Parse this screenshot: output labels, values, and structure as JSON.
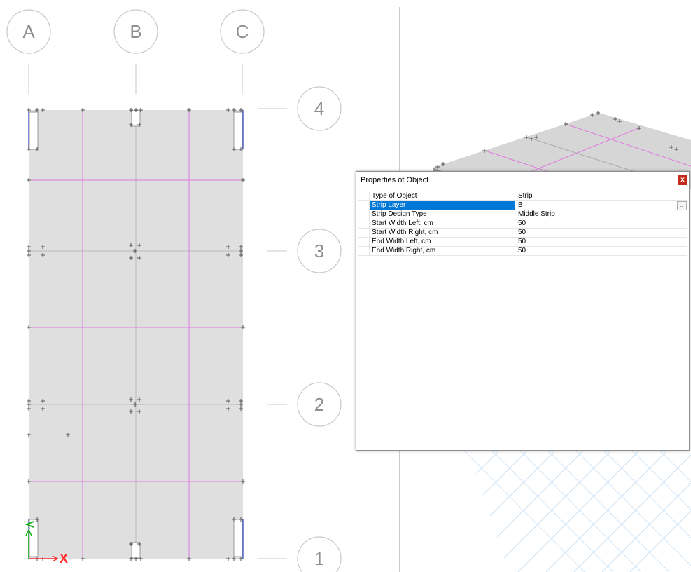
{
  "grid_lines": {
    "columns": [
      "A",
      "B",
      "C"
    ],
    "rows": [
      "4",
      "3",
      "2",
      "1"
    ]
  },
  "axis": {
    "x_label": "X"
  },
  "colors": {
    "slab": "#dfdfdf",
    "strip_line": "#e07ae0",
    "grid_bubble": "#bcbcbc",
    "axis_x": "#ff2b2b",
    "axis_y": "#18b018",
    "selection": "#0078d7",
    "close_button": "#c42b1c"
  },
  "dialog": {
    "title": "Properties of Object",
    "close_label": "x",
    "rows": [
      {
        "name": "Type of Object",
        "value": "Strip"
      },
      {
        "name": "Strip Layer",
        "value": "B"
      },
      {
        "name": "Strip Design Type",
        "value": "Middle Strip"
      },
      {
        "name": "Start Width Left, cm",
        "value": "50"
      },
      {
        "name": "Start Width Right, cm",
        "value": "50"
      },
      {
        "name": "End Width Left, cm",
        "value": "50"
      },
      {
        "name": "End Width Right, cm",
        "value": "50"
      }
    ],
    "selected_row": "Strip Layer",
    "dropdown_icon": "chevron-down-icon"
  }
}
